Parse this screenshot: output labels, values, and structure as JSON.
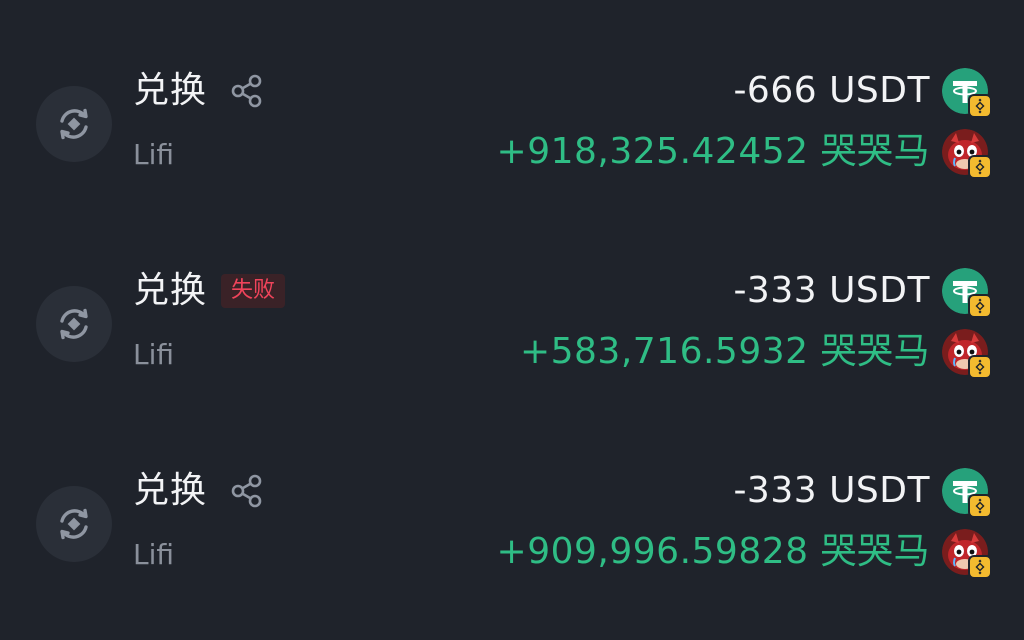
{
  "transactions": [
    {
      "title": "兑换",
      "has_share": true,
      "status_badge": "",
      "provider": "Lifi",
      "sent": "-666 USDT",
      "received": "+918,325.42452 哭哭马",
      "type_icon": "swap-icon",
      "sent_token_icon": "usdt-icon",
      "received_token_icon": "meme-token-icon",
      "chain_icon": "bnb-chain-icon"
    },
    {
      "title": "兑换",
      "has_share": false,
      "status_badge": "失败",
      "provider": "Lifi",
      "sent": "-333 USDT",
      "received": "+583,716.5932 哭哭马",
      "type_icon": "swap-icon",
      "sent_token_icon": "usdt-icon",
      "received_token_icon": "meme-token-icon",
      "chain_icon": "bnb-chain-icon"
    },
    {
      "title": "兑换",
      "has_share": true,
      "status_badge": "",
      "provider": "Lifi",
      "sent": "-333 USDT",
      "received": "+909,996.59828 哭哭马",
      "type_icon": "swap-icon",
      "sent_token_icon": "usdt-icon",
      "received_token_icon": "meme-token-icon",
      "chain_icon": "bnb-chain-icon"
    }
  ],
  "colors": {
    "background": "#1f232b",
    "icon_circle": "#2a2f38",
    "primary_text": "#f2f3f5",
    "secondary_text": "#8a909b",
    "positive": "#2fbd85",
    "failed": "#f0445b",
    "failed_badge_bg": "#3a2227",
    "usdt": "#26a17b",
    "bnb": "#f3ba2f"
  }
}
